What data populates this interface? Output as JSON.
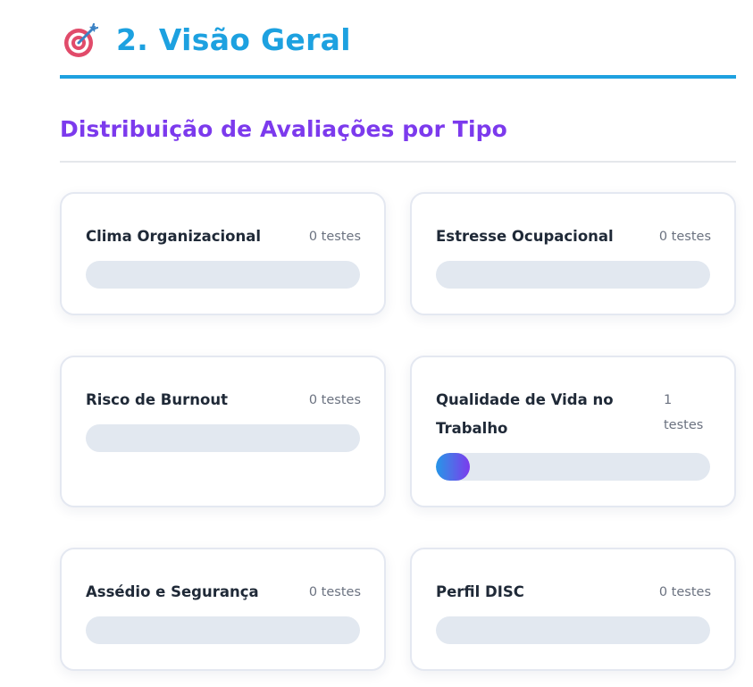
{
  "section": {
    "icon": "target-dart-icon",
    "title": "2. Visão Geral"
  },
  "distribution": {
    "subtitle": "Distribuição de Avaliações por Tipo",
    "cards": [
      {
        "label": "Clima Organizacional",
        "count_text": "0 testes",
        "count": 0,
        "fill_fraction": 0
      },
      {
        "label": "Estresse Ocupacional",
        "count_text": "0 testes",
        "count": 0,
        "fill_fraction": 0
      },
      {
        "label": "Risco de Burnout",
        "count_text": "0 testes",
        "count": 0,
        "fill_fraction": 0
      },
      {
        "label": "Qualidade de Vida no Trabalho",
        "count_text": "1 testes",
        "count": 1,
        "fill_fraction": 0.125
      },
      {
        "label": "Assédio e Segurança",
        "count_text": "0 testes",
        "count": 0,
        "fill_fraction": 0
      },
      {
        "label": "Perfil DISC",
        "count_text": "0 testes",
        "count": 0,
        "fill_fraction": 0
      }
    ]
  },
  "colors": {
    "title": "#1da1e0",
    "subtitle": "#7c3aed",
    "bar_track": "#e2e8f0",
    "bar_fill_start": "#2596e8",
    "bar_fill_end": "#7c3aed"
  }
}
